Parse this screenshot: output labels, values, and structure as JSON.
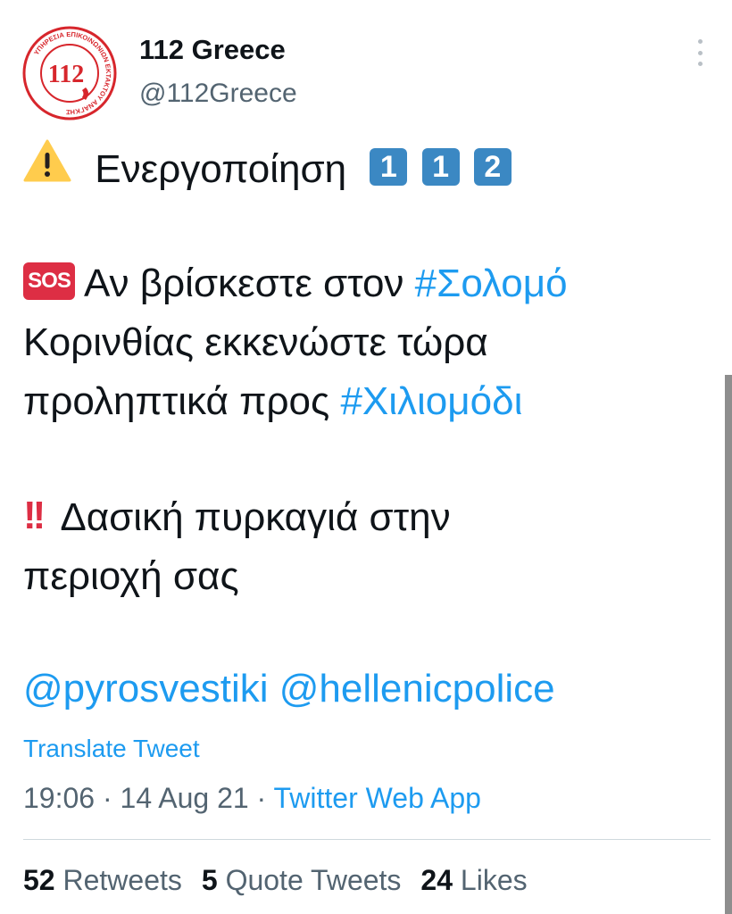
{
  "account": {
    "display_name": "112 Greece",
    "handle": "@112Greece",
    "avatar_number": "112",
    "avatar_ring_text": "ΥΠΗΡΕΣΙΑ ΕΠΙΚΟΙΝΩΝΙΩΝ ΕΚΤΑΚΤΟΥ ΑΝΑΓΚΗΣ"
  },
  "tweet": {
    "line1": {
      "icon": "warning-icon",
      "text": "Ενεργοποίηση",
      "keycaps": [
        "1",
        "1",
        "2"
      ]
    },
    "line2": {
      "icon": "sos-icon",
      "sos_label": "SOS",
      "text": "Αν βρίσκεστε στον",
      "hashtag": "#Σολομό"
    },
    "line3": {
      "text": "Κορινθίας εκκενώστε τώρα"
    },
    "line4": {
      "text": "προληπτικά προς",
      "hashtag": "#Χιλιομόδι"
    },
    "line5": {
      "icon": "double-exclamation-icon",
      "text": "Δασική πυρκαγιά στην"
    },
    "line6": {
      "text": "περιοχή σας"
    },
    "mentions": [
      "@pyrosvestiki",
      "@hellenicpolice"
    ]
  },
  "translate_label": "Translate Tweet",
  "meta": {
    "time": "19:06",
    "date": "14 Aug 21",
    "separator": "·",
    "source": "Twitter Web App"
  },
  "stats": {
    "retweets_count": "52",
    "retweets_label": "Retweets",
    "quotes_count": "5",
    "quotes_label": "Quote Tweets",
    "likes_count": "24",
    "likes_label": "Likes"
  },
  "colors": {
    "link": "#1d9bf0",
    "text": "#0f1419",
    "muted": "#536471",
    "keycap": "#3b88c3",
    "sos": "#dd2e44",
    "warning": "#ffcc4d"
  }
}
